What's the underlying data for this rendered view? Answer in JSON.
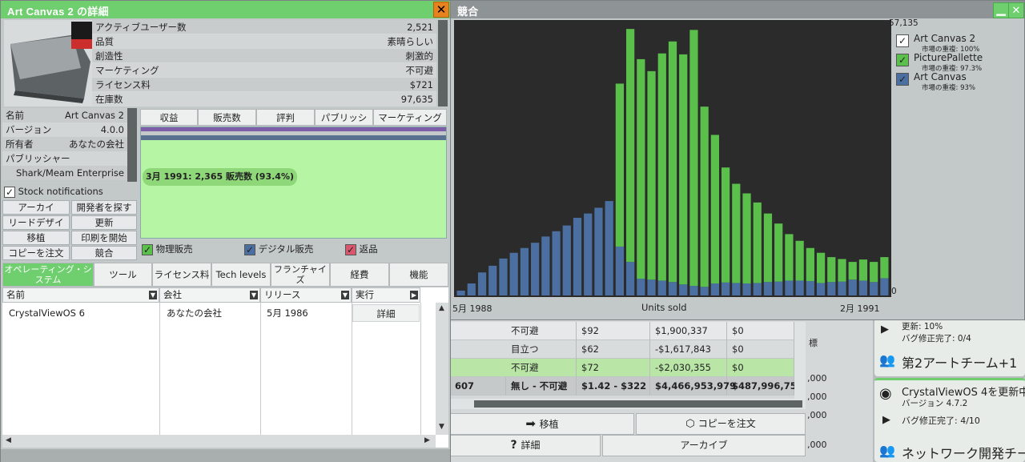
{
  "details": {
    "title": "Art Canvas 2 の詳細",
    "close": "✕",
    "stats": [
      {
        "label": "アクティブユーザー数",
        "value": "2,521"
      },
      {
        "label": "品質",
        "value": "素晴らしい"
      },
      {
        "label": "創造性",
        "value": "刺激的"
      },
      {
        "label": "マーケティング",
        "value": "不可避"
      },
      {
        "label": "ライセンス料",
        "value": "$721"
      },
      {
        "label": "在庫数",
        "value": "97,635"
      }
    ],
    "info": [
      {
        "label": "名前",
        "value": "Art Canvas 2"
      },
      {
        "label": "バージョン",
        "value": "4.0.0"
      },
      {
        "label": "所有者",
        "value": "あなたの会社"
      },
      {
        "label": "パブリッシャー",
        "value": ""
      },
      {
        "label": "",
        "value": "Shark/Meam Enterprise"
      }
    ],
    "stock_notifications": "Stock notifications",
    "buttons": [
      "アーカイ",
      "開発者を探す",
      "リードデザイ",
      "更新",
      "移植",
      "印刷を開始",
      "コピーを注文",
      "競合"
    ],
    "graph_tabs": [
      "収益",
      "販売数",
      "評判",
      "パブリッシ",
      "マーケティング"
    ],
    "graph_tooltip": "3月 1991: 2,365 販売数 (93.4%)",
    "graph_legend": [
      "物理販売",
      "デジタル販売",
      "返品"
    ],
    "bottom_tabs": [
      "オペレーティング・システム",
      "ツール",
      "ライセンス料",
      "Tech levels",
      "フランチャイズ",
      "経費",
      "機能"
    ],
    "columns": [
      "名前",
      "会社",
      "リリース",
      "実行"
    ],
    "rows": [
      {
        "name": "CrystalViewOS 6",
        "company": "あなたの会社",
        "release": "5月 1986",
        "action": "詳細"
      }
    ]
  },
  "competition": {
    "title": "競合",
    "y_max_label": "57,135",
    "y_min_label": "0",
    "x_start_label": "5月 1988",
    "x_end_label": "2月 1991",
    "x_title": "Units sold",
    "legend": [
      {
        "name": "Art Canvas 2",
        "overlap": "市場の重複: 100%",
        "color": "#ffffff"
      },
      {
        "name": "PicturePallette",
        "overlap": "市場の重複: 97.3%",
        "color": "#5bbf4b"
      },
      {
        "name": "Art Canvas",
        "overlap": "市場の重複: 93%",
        "color": "#4b6fa0"
      }
    ]
  },
  "chart_data": {
    "type": "bar",
    "title": "",
    "xlabel": "Units sold",
    "ylabel": "",
    "ylim": [
      0,
      57135
    ],
    "x_range": [
      "5月 1988",
      "2月 1991"
    ],
    "series": [
      {
        "name": "Art Canvas",
        "values": [
          1000,
          2500,
          4800,
          6200,
          7700,
          8900,
          9900,
          11000,
          12300,
          13400,
          14600,
          16200,
          17100,
          18300,
          19700,
          10200,
          7000,
          3500,
          3300,
          3100,
          2800,
          2300,
          2000,
          1800,
          2500,
          2700,
          2600,
          2500,
          2600,
          2800,
          2900,
          3100,
          3100,
          3000,
          2600,
          2800,
          2900,
          3300,
          3100,
          2800,
          3600
        ]
      },
      {
        "name": "PicturePallette",
        "values": [
          0,
          0,
          0,
          0,
          0,
          0,
          0,
          0,
          0,
          0,
          0,
          0,
          0,
          0,
          0,
          34000,
          48600,
          45800,
          43500,
          47400,
          50200,
          48000,
          53400,
          37600,
          31000,
          24000,
          20700,
          18800,
          16800,
          14300,
          12100,
          9700,
          8300,
          6900,
          6300,
          5200,
          4700,
          3700,
          4400,
          4200,
          4400
        ]
      }
    ]
  },
  "market_table": {
    "rows": [
      {
        "c1": "",
        "marketing": "不可避",
        "price": "$92",
        "revenue": "$1,900,337",
        "profit": "$0"
      },
      {
        "c1": "",
        "marketing": "目立つ",
        "price": "$62",
        "revenue": "-$1,617,843",
        "profit": "$0"
      },
      {
        "c1": "",
        "marketing": "不可避",
        "price": "$72",
        "revenue": "-$2,030,355",
        "profit": "$0"
      },
      {
        "c1": "607",
        "marketing": "無し - 不可避",
        "price": "$1.42 - $322",
        "revenue": "$4,466,953,979",
        "profit": "$487,996,759"
      }
    ],
    "btn_port": "移植",
    "btn_order": "コピーを注文",
    "btn_details": "詳細",
    "btn_archive": "アーカイブ"
  },
  "background": {
    "items": [
      "更新: 10%",
      "バグ修正完了: 0/4",
      "第2アートチーム+1",
      "CrystalViewOS 4を更新中",
      "バージョン 4.7.2",
      "バグ修正完了: 4/10",
      "ネットワーク開発チー"
    ],
    "numbers": [
      ",000",
      ",000",
      ",000",
      ",000",
      ",000",
      ",000",
      ",000",
      "標"
    ]
  }
}
